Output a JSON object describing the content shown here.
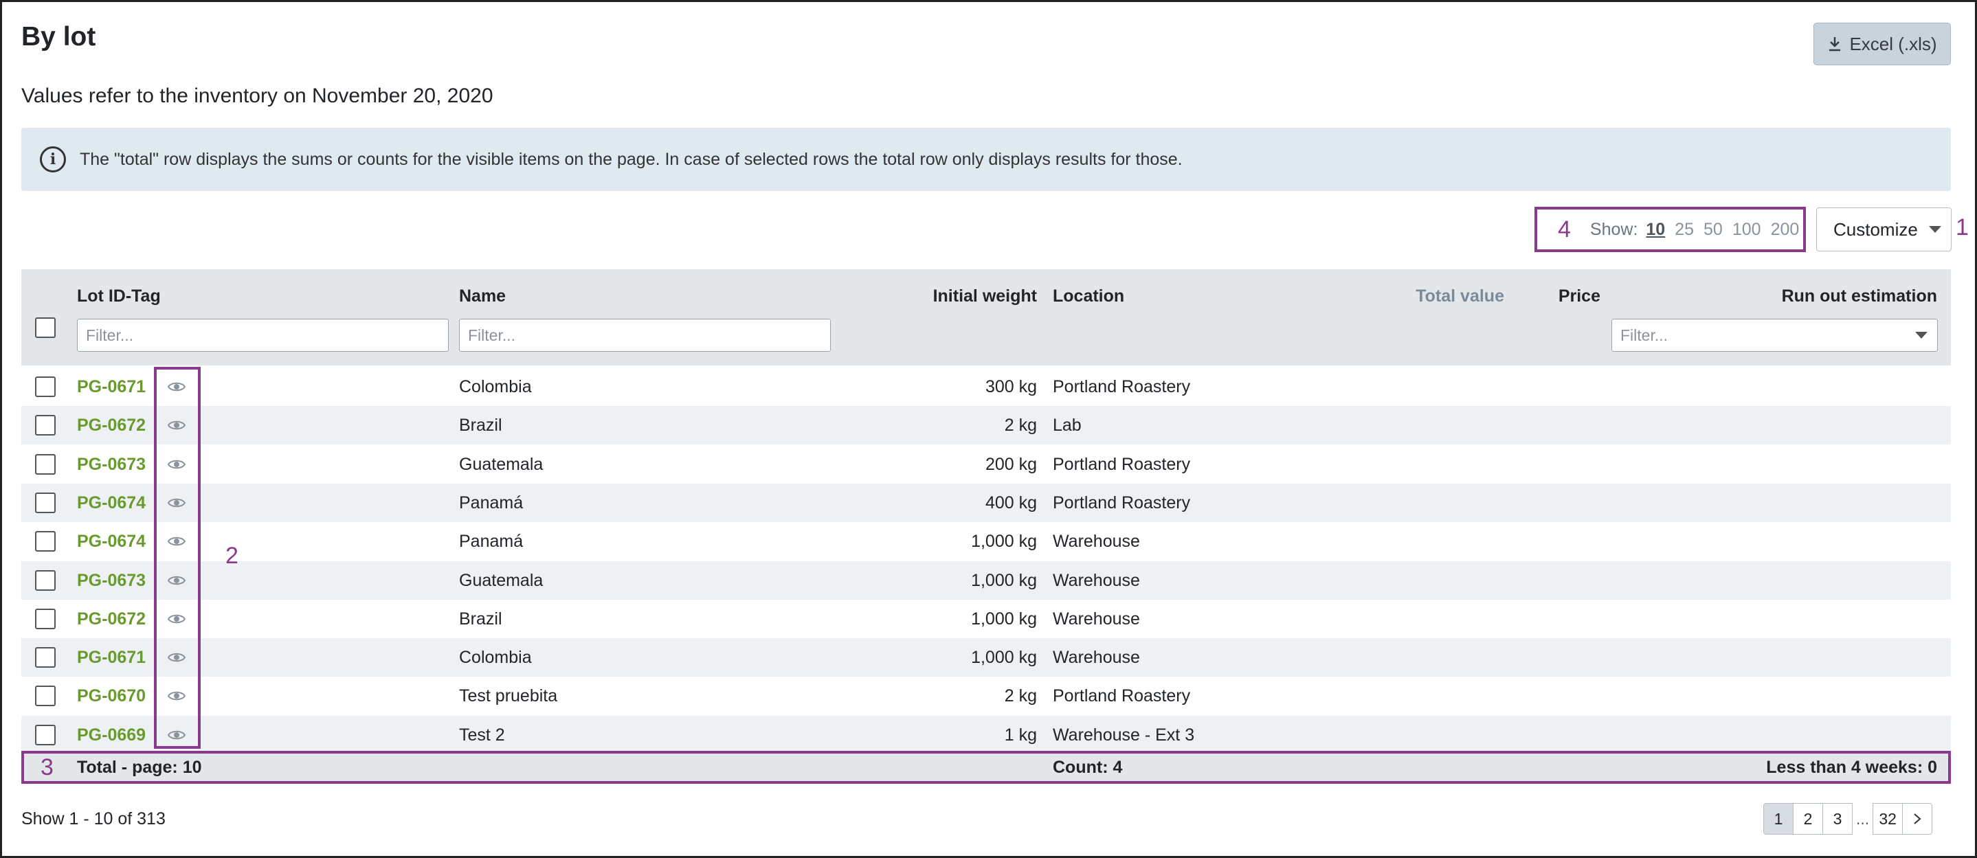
{
  "header": {
    "title": "By lot",
    "subtitle": "Values refer to the inventory on November 20, 2020",
    "export_label": "Excel (.xls)",
    "export_icon": "download-icon"
  },
  "info": {
    "icon": "info-icon",
    "text": "The \"total\" row displays the sums or counts for the visible items on the page. In case of selected rows the total row only displays results for those."
  },
  "page_size": {
    "label": "Show:",
    "options": [
      "10",
      "25",
      "50",
      "100",
      "200"
    ],
    "selected": "10"
  },
  "customize_label": "Customize",
  "annotations": {
    "a1": "1",
    "a2": "2",
    "a3": "3",
    "a4": "4"
  },
  "table": {
    "columns": {
      "lot": "Lot ID-Tag",
      "name": "Name",
      "weight": "Initial weight",
      "location": "Location",
      "total_value": "Total value",
      "price": "Price",
      "run_out": "Run out estimation"
    },
    "filters": {
      "lot_placeholder": "Filter...",
      "name_placeholder": "Filter...",
      "run_out_placeholder": "Filter..."
    },
    "rows": [
      {
        "lot": "PG-0671",
        "name": "Colombia",
        "weight": "300 kg",
        "location": "Portland Roastery"
      },
      {
        "lot": "PG-0672",
        "name": "Brazil",
        "weight": "2 kg",
        "location": "Lab"
      },
      {
        "lot": "PG-0673",
        "name": "Guatemala",
        "weight": "200 kg",
        "location": "Portland Roastery"
      },
      {
        "lot": "PG-0674",
        "name": "Panamá",
        "weight": "400 kg",
        "location": "Portland Roastery"
      },
      {
        "lot": "PG-0674",
        "name": "Panamá",
        "weight": "1,000 kg",
        "location": "Warehouse"
      },
      {
        "lot": "PG-0673",
        "name": "Guatemala",
        "weight": "1,000 kg",
        "location": "Warehouse"
      },
      {
        "lot": "PG-0672",
        "name": "Brazil",
        "weight": "1,000 kg",
        "location": "Warehouse"
      },
      {
        "lot": "PG-0671",
        "name": "Colombia",
        "weight": "1,000 kg",
        "location": "Warehouse"
      },
      {
        "lot": "PG-0670",
        "name": "Test pruebita",
        "weight": "2 kg",
        "location": "Portland Roastery"
      },
      {
        "lot": "PG-0669",
        "name": "Test 2",
        "weight": "1 kg",
        "location": "Warehouse - Ext 3"
      }
    ],
    "totals": {
      "label": "Total - page: 10",
      "location": "Count: 4",
      "run_out": "Less than 4 weeks: 0"
    }
  },
  "footer": {
    "range_text": "Show 1 - 10 of 313",
    "pages": [
      "1",
      "2",
      "3",
      "32"
    ],
    "current_page": "1",
    "ellipsis": "...",
    "next_icon": "chevron-right-icon"
  }
}
